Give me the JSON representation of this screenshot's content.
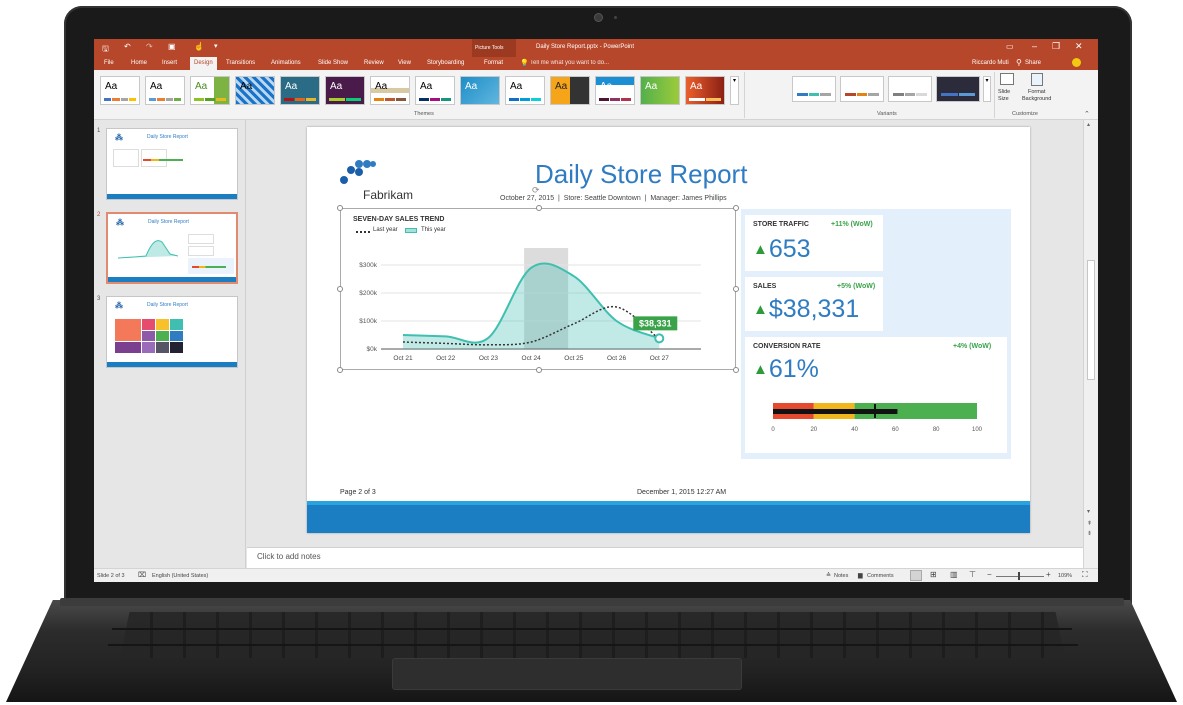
{
  "window": {
    "title": "Daily Store Report.pptx - PowerPoint",
    "context_tab_group": "Picture Tools",
    "user": "Riccardo Muti",
    "share_label": "Share",
    "tell_me_placeholder": "Tell me what you want to do..."
  },
  "tabs": [
    "File",
    "Home",
    "Insert",
    "Design",
    "Transitions",
    "Animations",
    "Slide Show",
    "Review",
    "View",
    "Storyboarding",
    "Format"
  ],
  "ribbon": {
    "themes_label": "Themes",
    "variants_label": "Variants",
    "customize_label": "Customize",
    "theme_glyph": "Aa",
    "slide_size_label": "Slide\nSize",
    "format_background_label": "Format\nBackground"
  },
  "thumbnails": [
    {
      "number": "1",
      "title": "Daily Store Report"
    },
    {
      "number": "2",
      "title": "Daily Store Report"
    },
    {
      "number": "3",
      "title": "Daily Store Report"
    }
  ],
  "slide": {
    "logo_text": "Fabrikam",
    "title": "Daily Store Report",
    "subtitle": "October 27, 2015  |  Store: Seattle Downtown  |  Manager: James Phillips",
    "footer_left": "Page 2 of 3",
    "footer_right": "December 1, 2015 12:27 AM",
    "kpis": {
      "traffic": {
        "title": "STORE TRAFFIC",
        "delta": "+11% (WoW)",
        "value": "653"
      },
      "sales": {
        "title": "SALES",
        "delta": "+5% (WoW)",
        "value": "$38,331"
      },
      "conversion": {
        "title": "CONVERSION RATE",
        "delta": "+4% (WoW)",
        "value": "61%"
      }
    },
    "trend_arrow": "▲"
  },
  "chart_data": [
    {
      "type": "line",
      "title": "SEVEN-DAY SALES TREND",
      "x": [
        "Oct 21",
        "Oct 22",
        "Oct 23",
        "Oct 24",
        "Oct 25",
        "Oct 26",
        "Oct 27"
      ],
      "y_ticks": [
        "$0k",
        "$100k",
        "$200k",
        "$300k"
      ],
      "ylim": [
        0,
        350
      ],
      "series": [
        {
          "name": "Last year",
          "values": [
            25,
            20,
            15,
            25,
            90,
            150,
            35
          ],
          "style": "dotted",
          "color": "#333333"
        },
        {
          "name": "This year",
          "values": [
            50,
            45,
            40,
            290,
            260,
            100,
            38
          ],
          "style": "area",
          "color": "#3fbfb0"
        }
      ],
      "highlight_category": "Oct 24",
      "data_label": {
        "category": "Oct 27",
        "text": "$38,331"
      },
      "grid": true,
      "legend": "top-left"
    },
    {
      "type": "bar",
      "title": "",
      "x_ticks": [
        "0",
        "20",
        "40",
        "60",
        "80",
        "100"
      ],
      "value": 61,
      "target": 50,
      "bands": [
        {
          "to": 20,
          "color": "#e64a2e"
        },
        {
          "to": 40,
          "color": "#f2b61d"
        },
        {
          "to": 100,
          "color": "#4caf50"
        }
      ]
    }
  ],
  "notes_placeholder": "Click to add notes",
  "status": {
    "slide_info": "Slide 2 of 3",
    "language": "English (United States)",
    "notes_label": "Notes",
    "comments_label": "Comments",
    "zoom": "109%"
  },
  "colors": {
    "accent": "#b7472a",
    "slide_title": "#2f7cc2",
    "teal": "#3fbfb0",
    "green": "#3aa34a",
    "footer_bar": "#1b7ec2"
  }
}
